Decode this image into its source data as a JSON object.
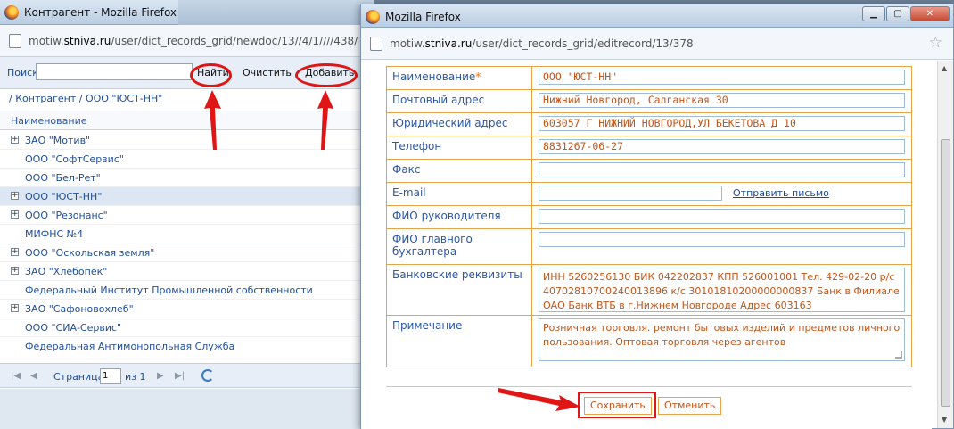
{
  "bg_window": {
    "title": "Контрагент - Mozilla Firefox",
    "url_prefix": "motiw.",
    "url_host": "stniva.ru",
    "url_path": "/user/dict_records_grid/newdoc/13//4/1////438/",
    "search_label": "Поиск",
    "search_value": "",
    "find_button": "Найти",
    "clear_button": "Очистить",
    "add_button": "Добавить",
    "breadcrumb_sep": "/",
    "breadcrumb_root": "Контрагент",
    "breadcrumb_current": "ООО \"ЮСТ-НН\"",
    "column_header": "Наименование",
    "tree_items": [
      {
        "label": "ЗАО \"Мотив\"",
        "expandable": true,
        "selected": false
      },
      {
        "label": "ООО \"СофтСервис\"",
        "expandable": false,
        "selected": false
      },
      {
        "label": "ООО \"Бел-Рет\"",
        "expandable": false,
        "selected": false
      },
      {
        "label": "ООО \"ЮСТ-НН\"",
        "expandable": true,
        "selected": true
      },
      {
        "label": "ООО \"Резонанс\"",
        "expandable": true,
        "selected": false
      },
      {
        "label": "МИФНС №4",
        "expandable": false,
        "selected": false
      },
      {
        "label": "ООО \"Оскольская земля\"",
        "expandable": true,
        "selected": false
      },
      {
        "label": "ЗАО \"Хлебопек\"",
        "expandable": true,
        "selected": false
      },
      {
        "label": "Федеральный Институт Промышленной собственности",
        "expandable": false,
        "selected": false
      },
      {
        "label": "ЗАО \"Сафоновохлеб\"",
        "expandable": true,
        "selected": false
      },
      {
        "label": "ООО \"СИА-Сервис\"",
        "expandable": false,
        "selected": false
      },
      {
        "label": "Федеральная Антимонопольная Служба",
        "expandable": false,
        "selected": false
      }
    ],
    "pager": {
      "page_label": "Страница",
      "page_value": "1",
      "of_label": "из 1"
    }
  },
  "dialog": {
    "title": "Mozilla Firefox",
    "url_prefix": "motiw.",
    "url_host": "stniva.ru",
    "url_path": "/user/dict_records_grid/editrecord/13/378",
    "fields": {
      "name_label": "Наименование",
      "name_required": "*",
      "name_value": "ООО \"ЮСТ-НН\"",
      "postal_label": "Почтовый адрес",
      "postal_value": "Нижний Новгород, Салганская 30",
      "legal_label": "Юридический адрес",
      "legal_value": "603057 Г НИЖНИЙ НОВГОРОД,УЛ БЕКЕТОВА Д 10",
      "phone_label": "Телефон",
      "phone_value": "8831267-06-27",
      "fax_label": "Факс",
      "fax_value": "",
      "email_label": "E-mail",
      "email_value": "",
      "send_email_link": "Отправить письмо",
      "director_label": "ФИО руководителя",
      "director_value": "",
      "accountant_label": "ФИО главного бухгалтера",
      "accountant_value": "",
      "bank_label": "Банковские реквизиты",
      "bank_value": "ИНН 5260256130 БИК 042202837 КПП 526001001 Тел. 429-02-20 р/с 40702810700240013896 к/с 30101810200000000837 Банк в Филиале ОАО Банк ВТБ в г.Нижнем Новгороде Адрес 603163",
      "note_label": "Примечание",
      "note_value": "Розничная торговля. ремонт бытовых изделий и предметов личного пользования. Оптовая торговля через агентов"
    },
    "save_button": "Сохранить",
    "cancel_button": "Отменить"
  },
  "colors": {
    "accent_orange": "#e8a24a",
    "value_text": "#c0561a",
    "link_blue": "#1f4e98",
    "annotation_red": "#e01515"
  }
}
